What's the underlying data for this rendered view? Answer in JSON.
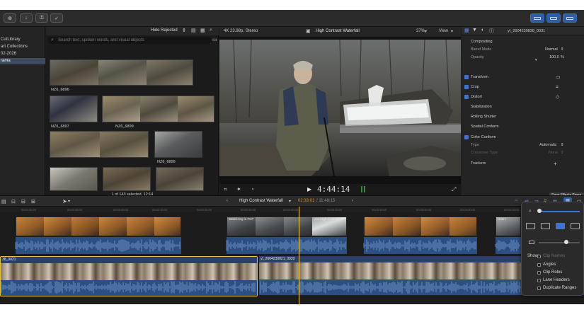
{
  "toolbar": {
    "left_icons": [
      "import-icon",
      "download-icon",
      "key-icon",
      "checkmark-icon"
    ],
    "right_icons": [
      "browser-layout-icon",
      "timeline-layout-icon",
      "inspector-layout-icon"
    ]
  },
  "libraries": {
    "items": [
      "CutLibrary",
      "art Collections",
      "02-2026",
      "rama"
    ],
    "selected_index": 3
  },
  "browser": {
    "filter_label": "Hide Rejected",
    "search_placeholder": "Search text, spoken words, and visual objects",
    "clip_labels": [
      "NZ6_6896",
      "NZ6_6897",
      "NZ6_6899",
      "NZ6_6899"
    ],
    "footer": "1 of 143 selected, 12:14"
  },
  "viewer": {
    "format": "4K 23.98p, Stereo",
    "title": "High Contrast Waterfall",
    "zoom": "37%",
    "view_label": "View",
    "timecode": "4:44:14"
  },
  "inspector": {
    "clip_name": "yt_2604230838_0031",
    "compositing_label": "Compositing",
    "blend_mode_label": "Blend Mode",
    "blend_mode_value": "Normal",
    "opacity_label": "Opacity",
    "opacity_value": "100,0",
    "opacity_unit": "%",
    "sections": [
      {
        "label": "Transform",
        "checked": true
      },
      {
        "label": "Crop",
        "checked": true
      },
      {
        "label": "Distort",
        "checked": true
      },
      {
        "label": "Stabilization",
        "checked": false
      },
      {
        "label": "Rolling Shutter",
        "checked": false
      },
      {
        "label": "Spatial Conform",
        "checked": false
      },
      {
        "label": "Color Conform",
        "checked": true
      }
    ],
    "type_label": "Type",
    "type_value": "Automatic",
    "crossover_label": "Crossover Type",
    "crossover_value": "None",
    "trackers_label": "Trackers",
    "save_preset_label": "Save Effects Prese"
  },
  "timeline": {
    "project_title": "High Contrast Waterfall",
    "position": "02:33:01",
    "duration": "/ 11:48:15",
    "ruler_ticks": [
      "00:01:30:00",
      "00:01:45:00",
      "00:02:00:00",
      "00:02:15:00",
      "00:02:30:00",
      "00:02:45:00",
      "00:03:00:00",
      "00:03:15:00",
      "00:03:30:00",
      "00:03:45:00",
      "00:04:00:00",
      "00:04:15:00"
    ],
    "connected_clip_labels": [
      "",
      "Stabilizing in FCP",
      "Use High Contrast W",
      "",
      "How t"
    ],
    "primary_clip_labels": [
      "38_0021",
      "yt_2604230821_0020"
    ]
  },
  "clip_appearance": {
    "show_label": "Show:",
    "options": [
      {
        "label": "Clip Names",
        "checked": false,
        "dim": true
      },
      {
        "label": "Angles",
        "checked": false
      },
      {
        "label": "Clip Roles",
        "checked": false
      },
      {
        "label": "Lane Headers",
        "checked": false
      },
      {
        "label": "Duplicate Ranges",
        "checked": false
      }
    ]
  },
  "colors": {
    "accent_blue": "#3f72d8",
    "primary_audio": "#2b4f80",
    "selection_yellow": "#e2c233",
    "playhead": "#ffd34a",
    "position_orange": "#d9892b"
  }
}
